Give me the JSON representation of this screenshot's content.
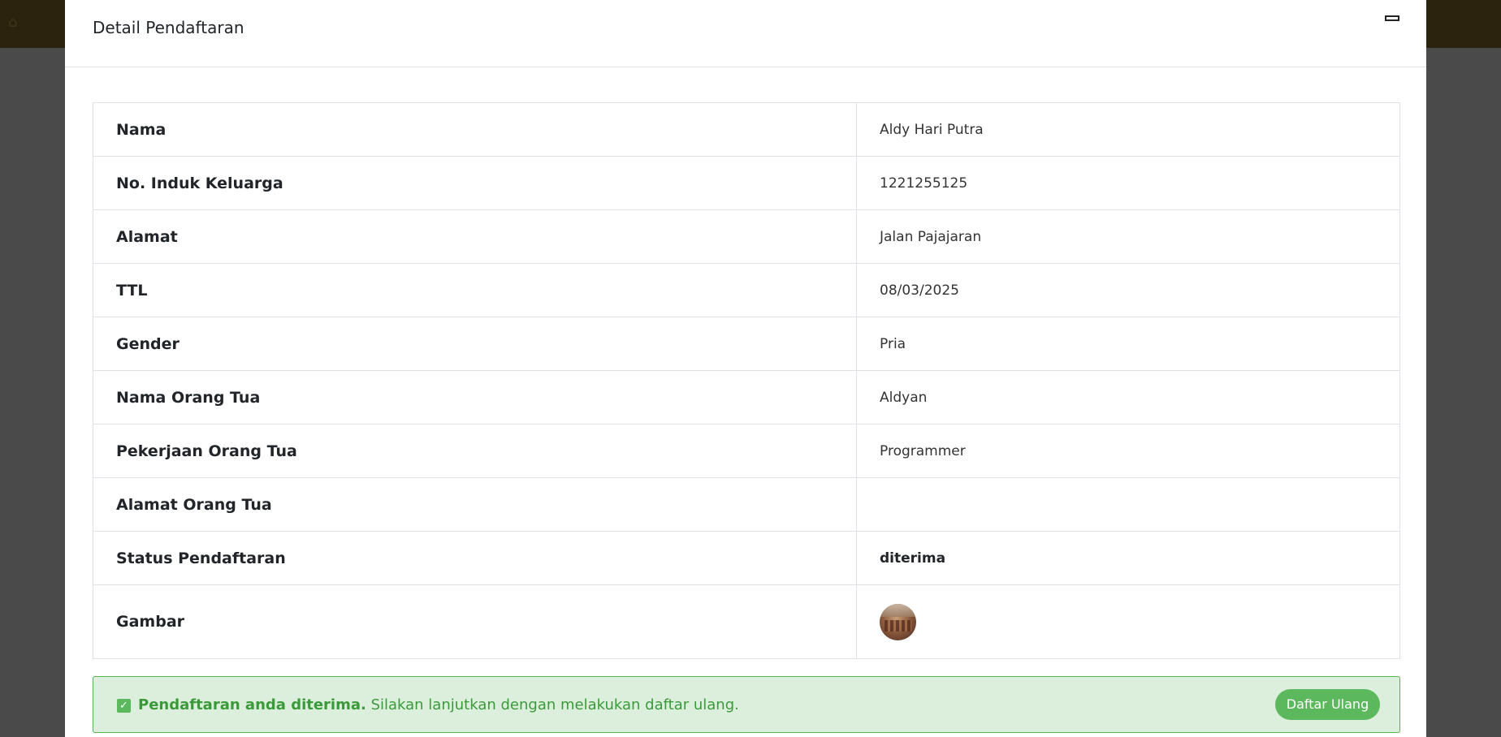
{
  "background": {
    "home_icon": "home-icon"
  },
  "modal": {
    "title": "Detail Pendaftaran",
    "minimize_icon": "minimize-icon"
  },
  "details": {
    "rows": [
      {
        "label": "Nama",
        "value": "Aldy Hari Putra"
      },
      {
        "label": "No. Induk Keluarga",
        "value": "1221255125"
      },
      {
        "label": "Alamat",
        "value": "Jalan Pajajaran"
      },
      {
        "label": "TTL",
        "value": "08/03/2025"
      },
      {
        "label": "Gender",
        "value": "Pria"
      },
      {
        "label": "Nama Orang Tua",
        "value": "Aldyan"
      },
      {
        "label": "Pekerjaan Orang Tua",
        "value": "Programmer"
      },
      {
        "label": "Alamat Orang Tua",
        "value": ""
      },
      {
        "label": "Status Pendaftaran",
        "value": "diterima"
      },
      {
        "label": "Gambar",
        "value": ""
      }
    ]
  },
  "alert": {
    "icon": "check-square-icon",
    "strong_text": "Pendaftaran anda diterima.",
    "text": " Silakan lanjutkan dengan melakukan daftar ulang.",
    "button_label": "Daftar Ulang"
  },
  "colors": {
    "success": "#5cb85c",
    "alert_bg": "#dcefdc",
    "alert_text": "#3a9a3a",
    "topbar": "#2b230e",
    "backdrop": "#4a4a4a"
  }
}
